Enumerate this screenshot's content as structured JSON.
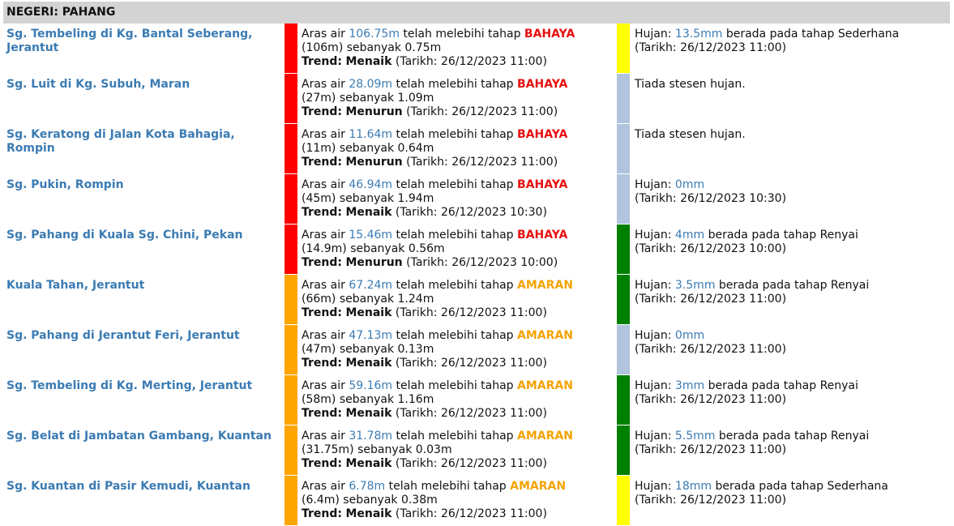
{
  "header": {
    "title": "NEGERI: PAHANG"
  },
  "labels": {
    "aras_air": "Aras air",
    "telah_melebihi": "telah melebihi tahap",
    "sebanyak": "sebanyak",
    "trend": "Trend:",
    "tarikh": "Tarikh:",
    "hujan": "Hujan:",
    "berada": "berada pada tahap",
    "tiada": "Tiada stesen hujan."
  },
  "colors": {
    "BAHAYA": "#ff0000",
    "AMARAN": "#ffa500",
    "Sederhana": "#ffff00",
    "Renyai": "#008000",
    "none": "#b0c4de"
  },
  "rows": [
    {
      "station": "Sg. Tembeling di Kg. Bantal Seberang, Jerantut",
      "level": "106.75m",
      "status": "BAHAYA",
      "threshold": "(106m)",
      "excess": "0.75m",
      "trend": "Menaik",
      "date": "26/12/2023 11:00",
      "rain": {
        "value": "13.5mm",
        "category": "Sederhana",
        "date": "26/12/2023 11:00"
      }
    },
    {
      "station": "Sg. Luit di Kg. Subuh, Maran",
      "level": "28.09m",
      "status": "BAHAYA",
      "threshold": "(27m)",
      "excess": "1.09m",
      "trend": "Menurun",
      "date": "26/12/2023 11:00",
      "rain": null
    },
    {
      "station": "Sg. Keratong di Jalan Kota Bahagia, Rompin",
      "level": "11.64m",
      "status": "BAHAYA",
      "threshold": "(11m)",
      "excess": "0.64m",
      "trend": "Menurun",
      "date": "26/12/2023 11:00",
      "rain": null
    },
    {
      "station": "Sg. Pukin, Rompin",
      "level": "46.94m",
      "status": "BAHAYA",
      "threshold": "(45m)",
      "excess": "1.94m",
      "trend": "Menaik",
      "date": "26/12/2023 10:30",
      "rain": {
        "value": "0mm",
        "category": "",
        "date": "26/12/2023 10:30"
      }
    },
    {
      "station": "Sg. Pahang di Kuala Sg. Chini, Pekan",
      "level": "15.46m",
      "status": "BAHAYA",
      "threshold": "(14.9m)",
      "excess": "0.56m",
      "trend": "Menurun",
      "date": "26/12/2023 10:00",
      "rain": {
        "value": "4mm",
        "category": "Renyai",
        "date": "26/12/2023 10:00"
      }
    },
    {
      "station": "Kuala Tahan, Jerantut",
      "level": "67.24m",
      "status": "AMARAN",
      "threshold": "(66m)",
      "excess": "1.24m",
      "trend": "Menaik",
      "date": "26/12/2023 11:00",
      "rain": {
        "value": "3.5mm",
        "category": "Renyai",
        "date": "26/12/2023 11:00"
      }
    },
    {
      "station": "Sg. Pahang di Jerantut Feri, Jerantut",
      "level": "47.13m",
      "status": "AMARAN",
      "threshold": "(47m)",
      "excess": "0.13m",
      "trend": "Menaik",
      "date": "26/12/2023 11:00",
      "rain": {
        "value": "0mm",
        "category": "",
        "date": "26/12/2023 11:00"
      }
    },
    {
      "station": "Sg. Tembeling di Kg. Merting, Jerantut",
      "level": "59.16m",
      "status": "AMARAN",
      "threshold": "(58m)",
      "excess": "1.16m",
      "trend": "Menaik",
      "date": "26/12/2023 11:00",
      "rain": {
        "value": "3mm",
        "category": "Renyai",
        "date": "26/12/2023 11:00"
      }
    },
    {
      "station": "Sg. Belat di Jambatan Gambang, Kuantan",
      "level": "31.78m",
      "status": "AMARAN",
      "threshold": "(31.75m)",
      "excess": "0.03m",
      "trend": "Menaik",
      "date": "26/12/2023 11:00",
      "rain": {
        "value": "5.5mm",
        "category": "Renyai",
        "date": "26/12/2023 11:00"
      }
    },
    {
      "station": "Sg. Kuantan di Pasir Kemudi, Kuantan",
      "level": "6.78m",
      "status": "AMARAN",
      "threshold": "(6.4m)",
      "excess": "0.38m",
      "trend": "Menaik",
      "date": "26/12/2023 11:00",
      "rain": {
        "value": "18mm",
        "category": "Sederhana",
        "date": "26/12/2023 11:00"
      }
    }
  ]
}
